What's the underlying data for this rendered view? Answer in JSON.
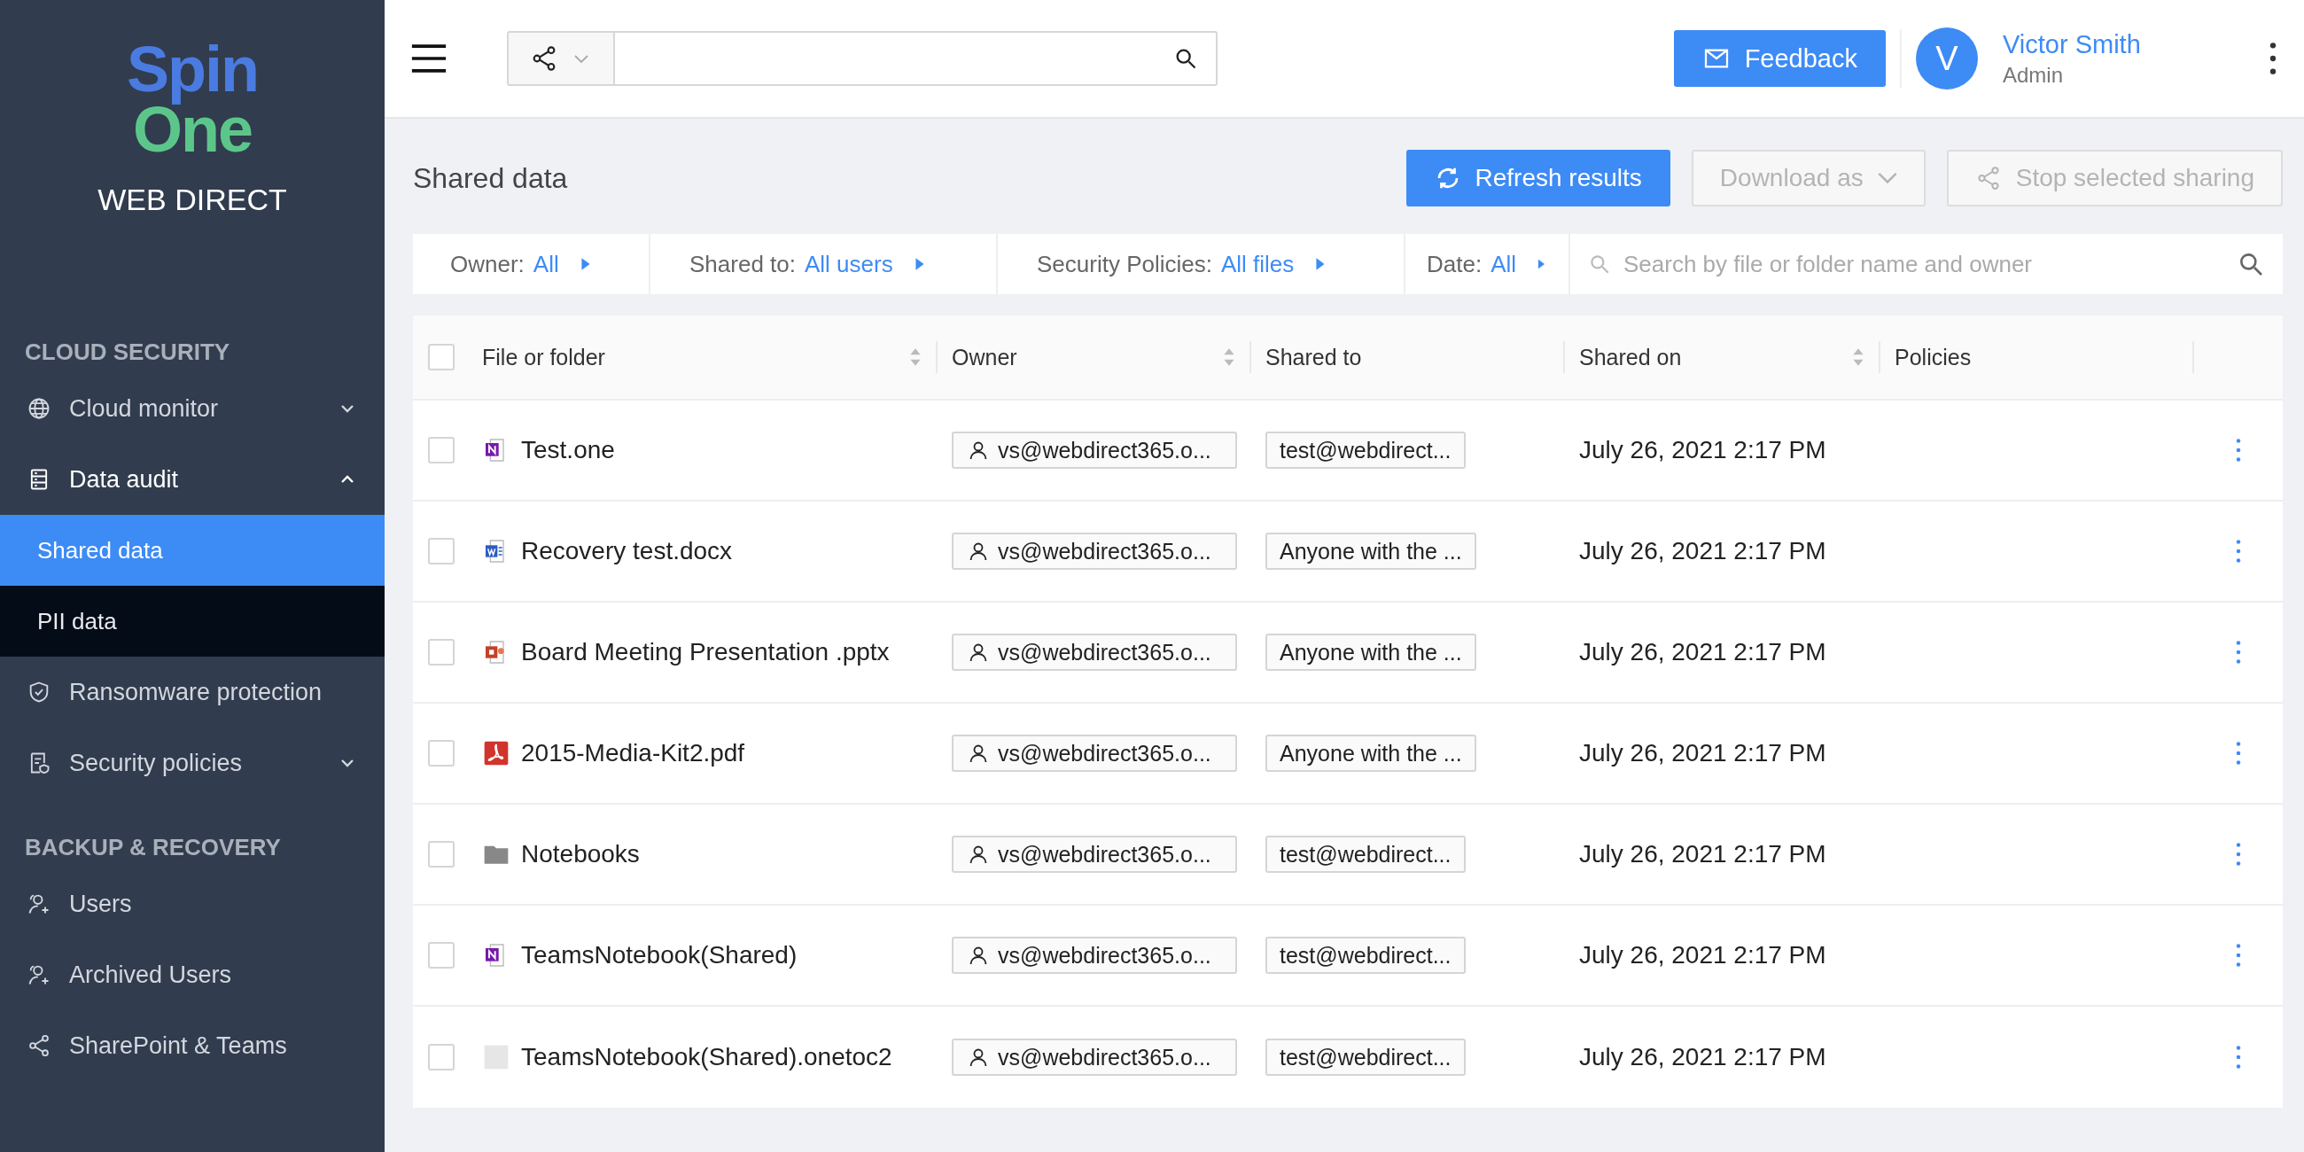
{
  "sidebar": {
    "logo": {
      "line1": "Spin",
      "line2": "One",
      "brand": "WEB DIRECT"
    },
    "sections": [
      {
        "title": "CLOUD SECURITY",
        "items": [
          {
            "label": "Cloud monitor",
            "expanded": false,
            "selected": false
          },
          {
            "label": "Data audit",
            "expanded": true,
            "selected": false,
            "children": [
              {
                "label": "Shared data",
                "selected": true
              },
              {
                "label": "PII data",
                "selected": false
              }
            ]
          },
          {
            "label": "Ransomware protection",
            "selected": false
          },
          {
            "label": "Security policies",
            "expanded": false,
            "selected": false
          }
        ]
      },
      {
        "title": "BACKUP & RECOVERY",
        "items": [
          {
            "label": "Users",
            "selected": false
          },
          {
            "label": "Archived Users",
            "selected": false
          },
          {
            "label": "SharePoint & Teams",
            "selected": false
          }
        ]
      }
    ]
  },
  "topbar": {
    "feedback": "Feedback",
    "user": {
      "initial": "V",
      "name": "Victor Smith",
      "role": "Admin"
    }
  },
  "page": {
    "title": "Shared data",
    "actions": [
      {
        "label": "Refresh results",
        "kind": "refresh",
        "disabled": false
      },
      {
        "label": "Download as",
        "kind": "dropdown",
        "disabled": true
      },
      {
        "label": "Stop selected sharing",
        "kind": "share",
        "disabled": true
      }
    ]
  },
  "filters": [
    {
      "label": "Owner:",
      "value": "All"
    },
    {
      "label": "Shared to:",
      "value": "All users"
    },
    {
      "label": "Security Policies:",
      "value": "All files"
    },
    {
      "label": "Date:",
      "value": "All"
    }
  ],
  "filter_search": {
    "placeholder": "Search by file or folder name and owner"
  },
  "table": {
    "select_all_checked": false,
    "columns": [
      {
        "label": "File or folder",
        "sortable": true
      },
      {
        "label": "Owner",
        "sortable": true
      },
      {
        "label": "Shared to",
        "sortable": false
      },
      {
        "label": "Shared on",
        "sortable": true
      },
      {
        "label": "Policies",
        "sortable": false
      }
    ],
    "rows": [
      {
        "checked": false,
        "kind": "onenote",
        "name": "Test.one",
        "owner": "vs@webdirect365.o...",
        "shared_to": "test@webdirect...",
        "shared_on": "July 26, 2021 2:17 PM"
      },
      {
        "checked": false,
        "kind": "word",
        "name": "Recovery test.docx",
        "owner": "vs@webdirect365.o...",
        "shared_to": "Anyone with the ...",
        "shared_on": "July 26, 2021 2:17 PM"
      },
      {
        "checked": false,
        "kind": "powerpoint",
        "name": "Board Meeting Presentation .pptx",
        "owner": "vs@webdirect365.o...",
        "shared_to": "Anyone with the ...",
        "shared_on": "July 26, 2021 2:17 PM"
      },
      {
        "checked": false,
        "kind": "pdf",
        "name": "2015-Media-Kit2.pdf",
        "owner": "vs@webdirect365.o...",
        "shared_to": "Anyone with the ...",
        "shared_on": "July 26, 2021 2:17 PM"
      },
      {
        "checked": false,
        "kind": "folder",
        "name": "Notebooks",
        "owner": "vs@webdirect365.o...",
        "shared_to": "test@webdirect...",
        "shared_on": "July 26, 2021 2:17 PM"
      },
      {
        "checked": false,
        "kind": "onenote",
        "name": "TeamsNotebook(Shared)",
        "owner": "vs@webdirect365.o...",
        "shared_to": "test@webdirect...",
        "shared_on": "July 26, 2021 2:17 PM"
      },
      {
        "checked": false,
        "kind": "blank",
        "name": "TeamsNotebook(Shared).onetoc2",
        "owner": "vs@webdirect365.o...",
        "shared_to": "test@webdirect...",
        "shared_on": "July 26, 2021 2:17 PM"
      }
    ]
  }
}
